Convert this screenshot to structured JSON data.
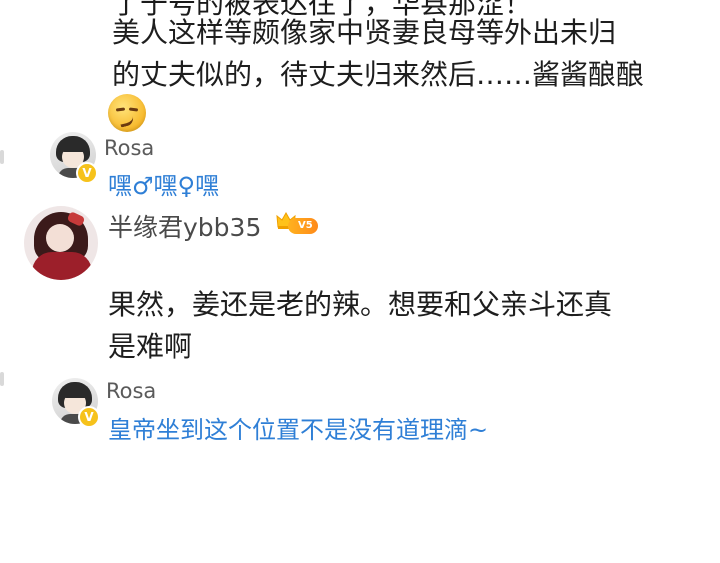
{
  "top_partial_text": "了于号的被表达往了，华县那涩！",
  "comment1": {
    "line1": "美人这样等颇像家中贤妻良母等外出未归",
    "line2": "的丈夫似的，待丈夫归来然后……酱酱酿酿",
    "emoji": "smirk-emoji"
  },
  "reply1": {
    "username": "Rosa",
    "badge": "V",
    "text": "嘿♂嘿♀嘿"
  },
  "comment2": {
    "username": "半缘君ybb35",
    "level": "V5",
    "line1": "果然，姜还是老的辣。想要和父亲斗还真",
    "line2": "是难啊"
  },
  "reply2": {
    "username": "Rosa",
    "badge": "V",
    "text": "皇帝坐到这个位置不是没有道理滴~"
  },
  "colors": {
    "reply_blue": "#2f7fd6",
    "username_gray": "#5a5a5a",
    "badge_gold": "#f6c21b",
    "level_orange": "#ff8a1a"
  }
}
